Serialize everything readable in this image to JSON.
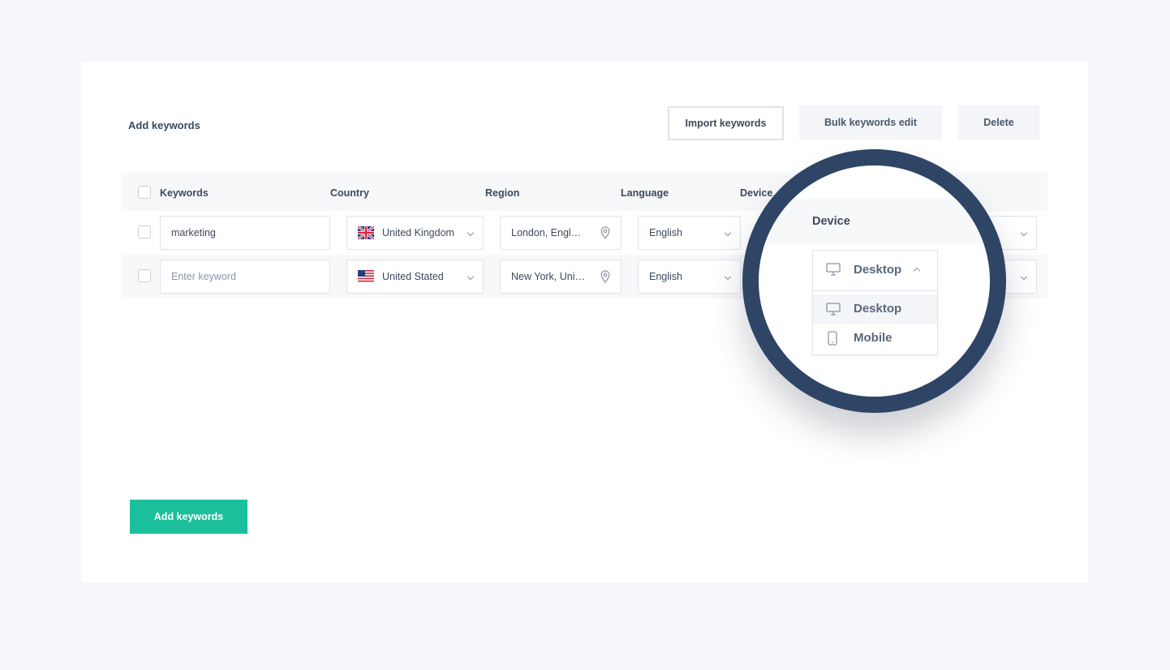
{
  "header": {
    "title": "Add keywords",
    "import_label": "Import keywords",
    "bulk_label": "Bulk keywords edit",
    "delete_label": "Delete"
  },
  "table": {
    "columns": [
      "Keywords",
      "Country",
      "Region",
      "Language",
      "Device"
    ],
    "rows": [
      {
        "keyword": "",
        "country": "United Kingdom",
        "flag": "uk-flag-icon",
        "region": "London, Engl…",
        "language": "English"
      },
      {
        "keyword": "",
        "country": "United Stated",
        "flag": "us-flag-icon",
        "region": "New York, Uni…",
        "language": "English"
      }
    ],
    "row1_keyword_value": "marketing",
    "keyword_placeholder": "Enter keyword"
  },
  "magnifier": {
    "title": "Device",
    "selected": "Desktop",
    "options": [
      "Desktop",
      "Mobile"
    ]
  },
  "footer": {
    "add_label": "Add keywords"
  },
  "colors": {
    "accent": "#1cbf9c",
    "magnifier_ring": "#2f4566",
    "background": "#f5f7fa"
  }
}
